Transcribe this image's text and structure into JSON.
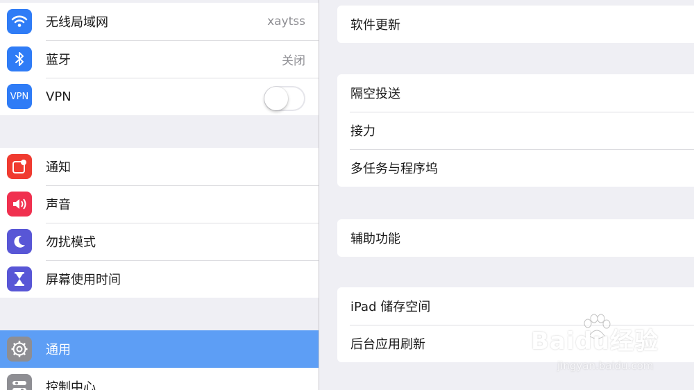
{
  "sidebar": {
    "group1": [
      {
        "label": "无线局域网",
        "value": "xaytss",
        "icon": "wifi-icon",
        "color": "#2f7cf6"
      },
      {
        "label": "蓝牙",
        "value": "关闭",
        "icon": "bluetooth-icon",
        "color": "#2f7cf6"
      },
      {
        "label": "VPN",
        "icon_text": "VPN",
        "toggle": false,
        "icon": "vpn-icon",
        "color": "#2f7cf6"
      }
    ],
    "group2": [
      {
        "label": "通知",
        "icon": "notifications-icon",
        "color": "#f03b30"
      },
      {
        "label": "声音",
        "icon": "sound-icon",
        "color": "#f0304f"
      },
      {
        "label": "勿扰模式",
        "icon": "moon-icon",
        "color": "#5856d6"
      },
      {
        "label": "屏幕使用时间",
        "icon": "hourglass-icon",
        "color": "#5856d6"
      }
    ],
    "group3": [
      {
        "label": "通用",
        "icon": "gear-icon",
        "color": "#8e8e93",
        "selected": true
      },
      {
        "label": "控制中心",
        "icon": "control-center-icon",
        "color": "#8e8e93"
      }
    ]
  },
  "detail": {
    "group1": [
      "软件更新"
    ],
    "group2": [
      "隔空投送",
      "接力",
      "多任务与程序坞"
    ],
    "group3": [
      "辅助功能"
    ],
    "group4": [
      "iPad 储存空间",
      "后台应用刷新"
    ]
  },
  "watermark": {
    "main": "Baidu经验",
    "sub": "jingyan.baidu.com"
  },
  "colors": {
    "selected": "#5d9ef5",
    "background": "#efeff4"
  }
}
